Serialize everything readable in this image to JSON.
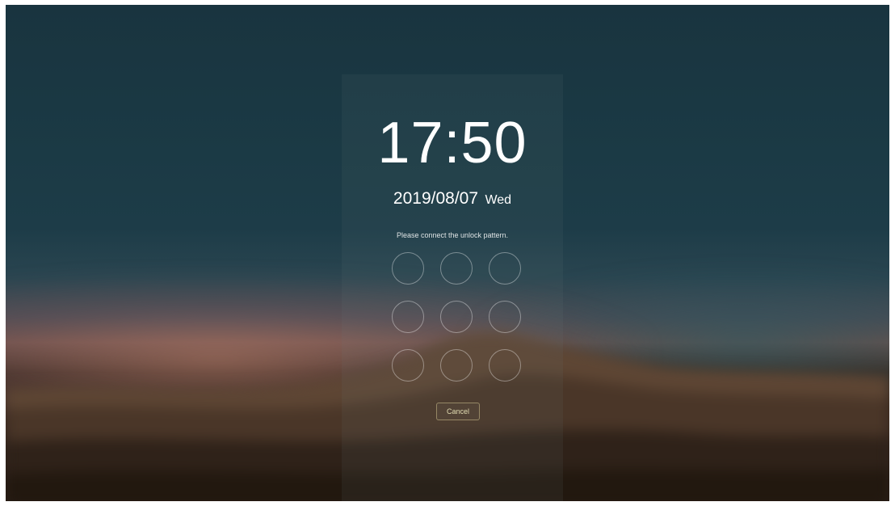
{
  "lock_screen": {
    "time": "17:50",
    "date": "2019/08/07",
    "weekday": "Wed",
    "prompt": "Please connect the unlock pattern.",
    "pattern_dots": 9,
    "cancel_label": "Cancel"
  },
  "colors": {
    "text": "#ffffff",
    "cancel_text": "#f0ebbe",
    "dot_stroke": "#ffffff"
  }
}
